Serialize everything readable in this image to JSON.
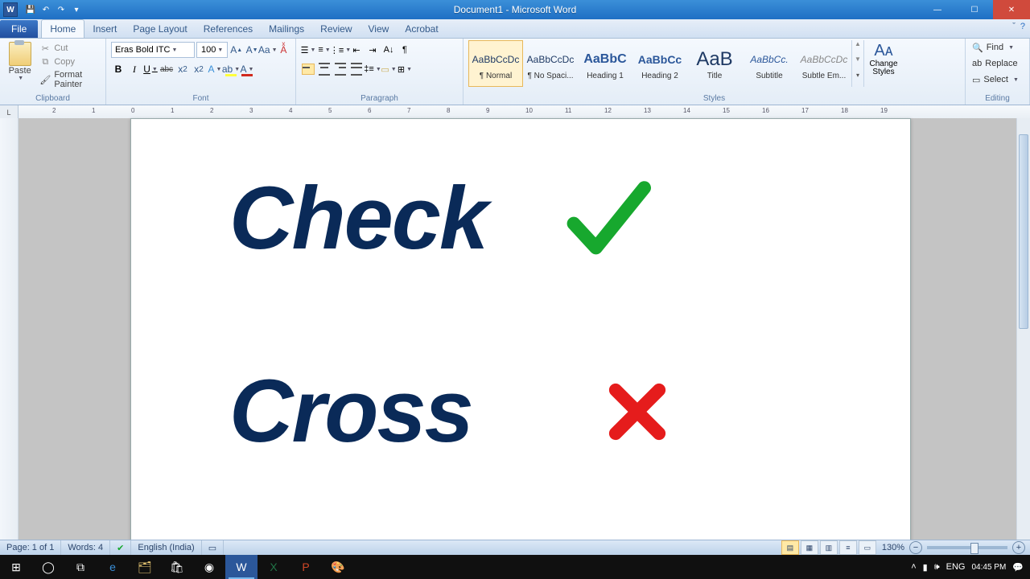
{
  "titlebar": {
    "title": "Document1 - Microsoft Word"
  },
  "tabs": {
    "file": "File",
    "home": "Home",
    "insert": "Insert",
    "pagelayout": "Page Layout",
    "references": "References",
    "mailings": "Mailings",
    "review": "Review",
    "view": "View",
    "acrobat": "Acrobat"
  },
  "clipboard": {
    "group": "Clipboard",
    "paste": "Paste",
    "cut": "Cut",
    "copy": "Copy",
    "fmt": "Format Painter"
  },
  "font": {
    "group": "Font",
    "name": "Eras Bold ITC",
    "size": "100"
  },
  "paragraph": {
    "group": "Paragraph"
  },
  "styles": {
    "group": "Styles",
    "items": [
      {
        "preview": "AaBbCcDc",
        "name": "¶ Normal"
      },
      {
        "preview": "AaBbCcDc",
        "name": "¶ No Spaci..."
      },
      {
        "preview": "AaBbC",
        "name": "Heading 1"
      },
      {
        "preview": "AaBbCc",
        "name": "Heading 2"
      },
      {
        "preview": "AaB",
        "name": "Title"
      },
      {
        "preview": "AaBbCc.",
        "name": "Subtitle"
      },
      {
        "preview": "AaBbCcDc",
        "name": "Subtle Em..."
      }
    ],
    "change": "Change Styles"
  },
  "editing": {
    "group": "Editing",
    "find": "Find",
    "replace": "Replace",
    "select": "Select"
  },
  "document": {
    "line1": "Check",
    "line2": "Cross"
  },
  "status": {
    "page": "Page: 1 of 1",
    "words": "Words: 4",
    "lang": "English (India)",
    "zoom": "130%"
  },
  "taskbar": {
    "lang": "ENG",
    "time": "04:45 PM"
  }
}
